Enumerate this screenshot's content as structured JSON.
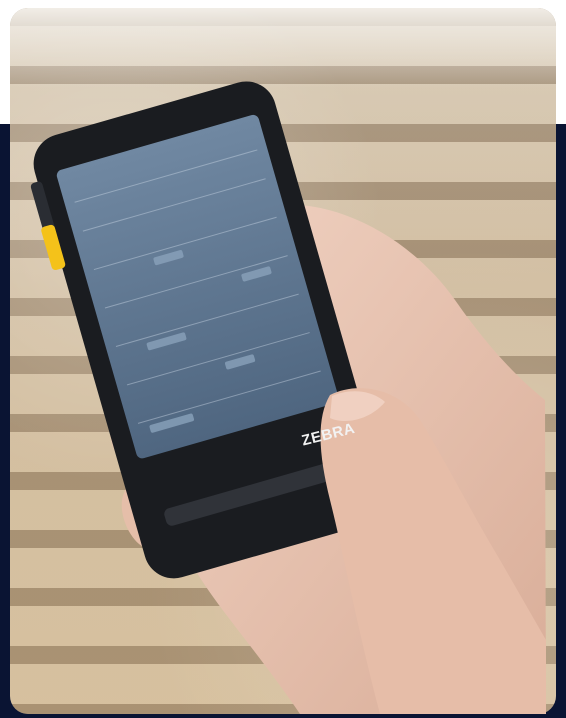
{
  "image": {
    "description_tags": [
      "hand-holding-phone",
      "rugged-smartphone",
      "calendar-screen",
      "blurred-wood-background"
    ],
    "phone_brand_label": "ZEBRA",
    "colors": {
      "page_background": "#0a1433",
      "top_band": "#ffffff",
      "phone_body": "#1a1c20",
      "screen": "#5f7590",
      "side_button": "#f4c21a",
      "skin": "#e9c6b4"
    }
  }
}
